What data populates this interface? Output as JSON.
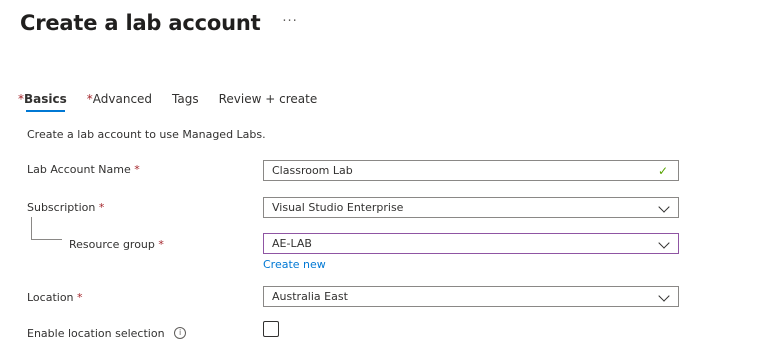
{
  "page": {
    "title": "Create a lab account",
    "more_icon": "ellipsis-icon"
  },
  "tabs": [
    {
      "label": "Basics",
      "required": "*",
      "active": true
    },
    {
      "label": "Advanced",
      "required": "*",
      "active": false
    },
    {
      "label": "Tags",
      "required": "",
      "active": false
    },
    {
      "label": "Review + create",
      "required": "",
      "active": false
    }
  ],
  "intro": "Create a lab account to use Managed Labs.",
  "form": {
    "lab_name": {
      "label": "Lab Account Name",
      "required": "*",
      "value": "Classroom Lab",
      "status_icon": "check-icon"
    },
    "subscription": {
      "label": "Subscription",
      "required": "*",
      "value": "Visual Studio Enterprise"
    },
    "resource_group": {
      "label": "Resource group",
      "required": "*",
      "value": "AE-LAB",
      "create_new": "Create new"
    },
    "location": {
      "label": "Location",
      "required": "*",
      "value": "Australia East"
    },
    "enable_location": {
      "label": "Enable location selection",
      "checked": false,
      "info_icon": "info-icon"
    }
  },
  "colors": {
    "accent": "#0078d4",
    "required": "#a4262c",
    "focus_border": "#8f55a3",
    "valid": "#57a300"
  }
}
